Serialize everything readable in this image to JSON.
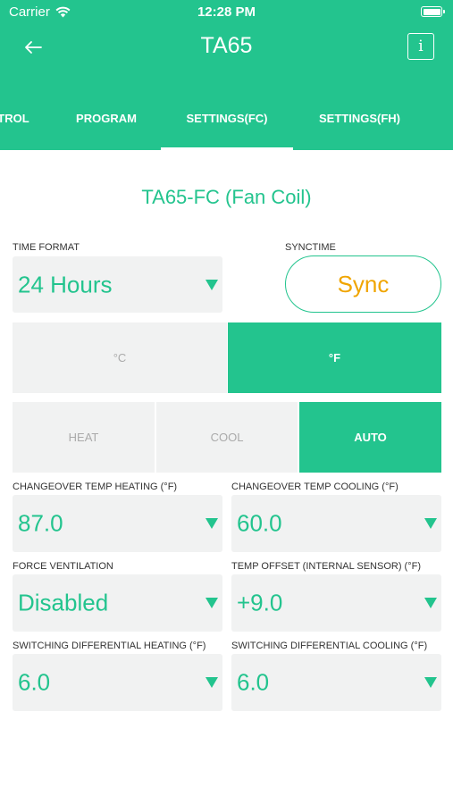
{
  "status_bar": {
    "carrier": "Carrier",
    "time": "12:28 PM"
  },
  "nav": {
    "title": "TA65",
    "back_icon": "arrow-left-icon",
    "info_label": "i"
  },
  "tabs": [
    {
      "label": "TROL",
      "active": false
    },
    {
      "label": "PROGRAM",
      "active": false
    },
    {
      "label": "SETTINGS(FC)",
      "active": true
    },
    {
      "label": "SETTINGS(FH)",
      "active": false
    }
  ],
  "device_title": "TA65-FC (Fan Coil)",
  "time_format": {
    "label": "TIME FORMAT",
    "value": "24 Hours"
  },
  "synctime": {
    "label": "SYNCTIME",
    "button": "Sync"
  },
  "units": {
    "celsius": "°C",
    "fahrenheit": "°F",
    "selected": "°F"
  },
  "modes": {
    "heat": "HEAT",
    "cool": "COOL",
    "auto": "AUTO",
    "selected": "AUTO"
  },
  "fields": {
    "changeover_heating": {
      "label": "CHANGEOVER TEMP HEATING (°F)",
      "value": "87.0"
    },
    "changeover_cooling": {
      "label": "CHANGEOVER TEMP COOLING (°F)",
      "value": "60.0"
    },
    "force_ventilation": {
      "label": "FORCE VENTILATION",
      "value": "Disabled"
    },
    "temp_offset": {
      "label": "TEMP OFFSET (INTERNAL SENSOR) (°F)",
      "value": "+9.0"
    },
    "switch_diff_heating": {
      "label": "SWITCHING DIFFERENTIAL HEATING (°F)",
      "value": "6.0"
    },
    "switch_diff_cooling": {
      "label": "SWITCHING DIFFERENTIAL COOLING (°F)",
      "value": "6.0"
    }
  },
  "colors": {
    "accent": "#23c48e",
    "sync_text": "#f0a500",
    "field_bg": "#f1f2f2"
  }
}
